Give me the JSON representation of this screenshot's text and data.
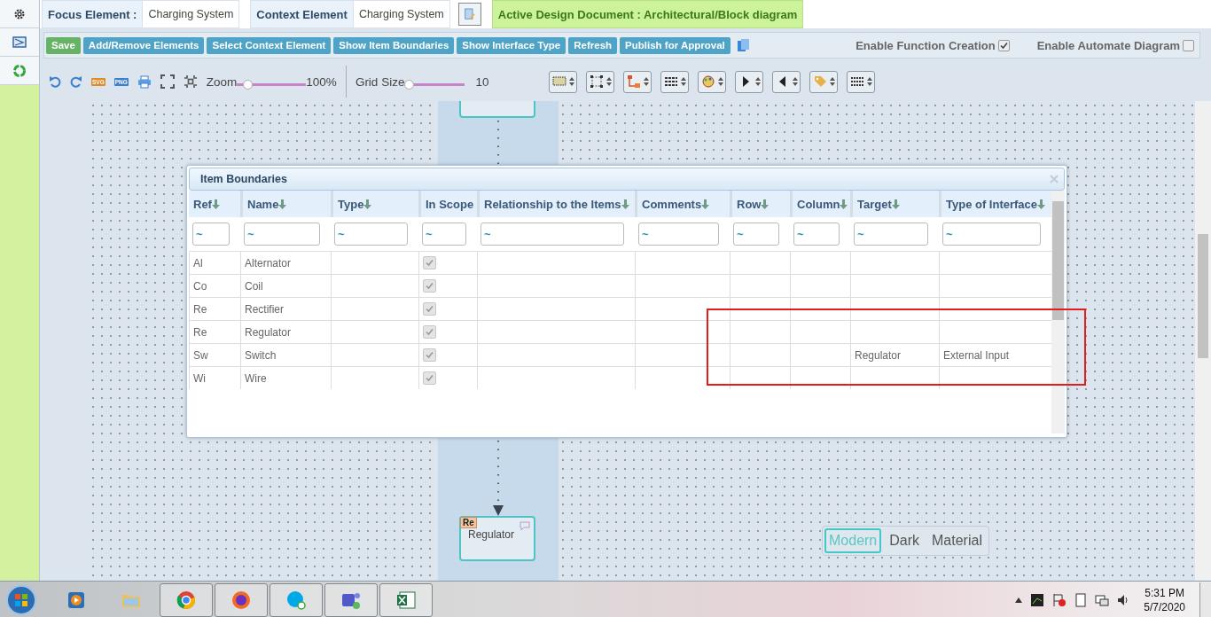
{
  "header": {
    "focus_label": "Focus Element :",
    "focus_value": "Charging System",
    "context_label": "Context Element",
    "context_value": "Charging System",
    "active_document": "Active Design Document : Architectural/Block diagram"
  },
  "actions": [
    {
      "label": "Save",
      "kind": "save"
    },
    {
      "label": "Add/Remove Elements",
      "kind": "action"
    },
    {
      "label": "Select Context Element",
      "kind": "action"
    },
    {
      "label": "Show Item Boundaries",
      "kind": "action"
    },
    {
      "label": "Show Interface Type",
      "kind": "action"
    },
    {
      "label": "Refresh",
      "kind": "action"
    },
    {
      "label": "Publish for Approval",
      "kind": "action"
    }
  ],
  "options": [
    {
      "label": "Enable Function Creation",
      "checked": true
    },
    {
      "label": "Enable Automate Diagram",
      "checked": false
    }
  ],
  "export_formats": [
    "SVG",
    "PNG"
  ],
  "zoom": {
    "label": "Zoom",
    "level": 0.15,
    "reading": "100%"
  },
  "grid_size": {
    "label": "Grid Size",
    "level": 0.07,
    "reading": "10"
  },
  "dialog": {
    "title": "Item Boundaries",
    "columns": [
      {
        "label": "Ref",
        "sortable": true,
        "filter": "~"
      },
      {
        "label": "Name",
        "sortable": true,
        "filter": "~"
      },
      {
        "label": "Type",
        "sortable": true,
        "filter": "~"
      },
      {
        "label": "In Scope",
        "sortable": false,
        "filter": "~"
      },
      {
        "label": "Relationship to the Items",
        "sortable": true,
        "filter": "~"
      },
      {
        "label": "Comments",
        "sortable": true,
        "filter": "~"
      },
      {
        "label": "Row",
        "sortable": true,
        "filter": "~"
      },
      {
        "label": "Column",
        "sortable": true,
        "filter": "~"
      },
      {
        "label": "Target",
        "sortable": true,
        "filter": "~"
      },
      {
        "label": "Type of Interface",
        "sortable": true,
        "filter": "~"
      }
    ],
    "rows": [
      {
        "ref": "Al",
        "name": "Alternator",
        "in_scope": true
      },
      {
        "ref": "Co",
        "name": "Coil",
        "in_scope": true
      },
      {
        "ref": "Re",
        "name": "Rectifier",
        "in_scope": true
      },
      {
        "ref": "Re",
        "name": "Regulator",
        "in_scope": true
      },
      {
        "ref": "Sw",
        "name": "Switch",
        "in_scope": true,
        "target": "Regulator",
        "type_of_interface": "External Input"
      },
      {
        "ref": "Wi",
        "name": "Wire",
        "in_scope": true
      }
    ]
  },
  "canvas": {
    "nodes": [
      {
        "ref": "Re",
        "name": "Regulator"
      }
    ]
  },
  "themes": [
    {
      "label": "Modern",
      "selected": true
    },
    {
      "label": "Dark",
      "selected": false
    },
    {
      "label": "Material",
      "selected": false
    }
  ],
  "taskbar": {
    "apps": [
      {
        "kind": "media",
        "running": false
      },
      {
        "kind": "folder",
        "running": false
      },
      {
        "kind": "chrome",
        "running": true
      },
      {
        "kind": "firefox",
        "running": true
      },
      {
        "kind": "skype",
        "running": true
      },
      {
        "kind": "teams",
        "running": true
      },
      {
        "kind": "excel",
        "running": true
      }
    ],
    "clock": {
      "time": "5:31 PM",
      "date": "5/7/2020"
    }
  }
}
